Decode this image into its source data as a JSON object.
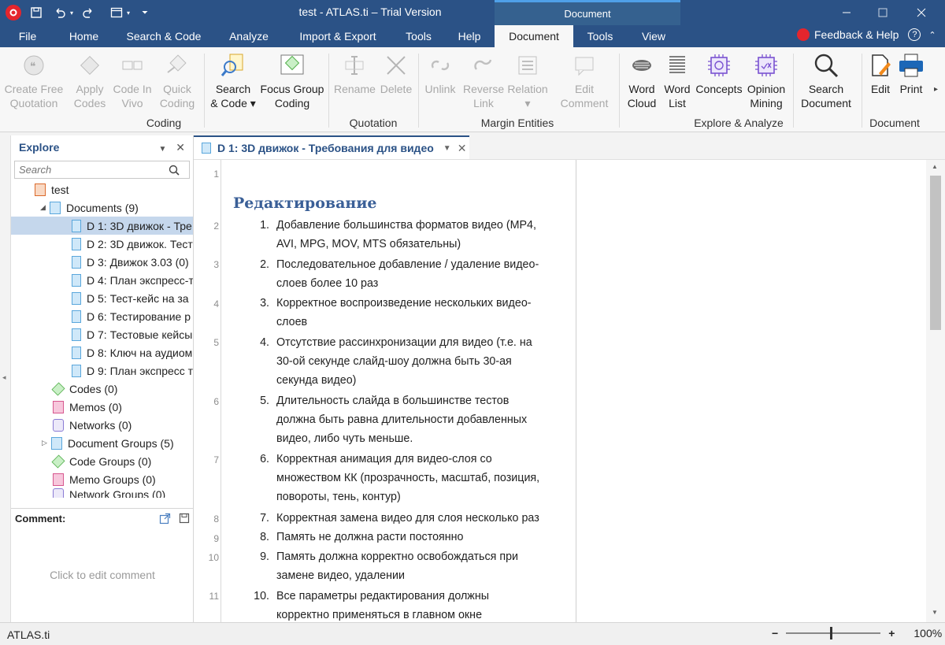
{
  "window": {
    "title": "test - ATLAS.ti – Trial Version",
    "context_tab_group": "Document"
  },
  "menu_tabs": [
    {
      "label": "File"
    },
    {
      "label": "Home"
    },
    {
      "label": "Search & Code"
    },
    {
      "label": "Analyze"
    },
    {
      "label": "Import & Export"
    },
    {
      "label": "Tools"
    },
    {
      "label": "Help"
    },
    {
      "label": "Document"
    },
    {
      "label": "Tools"
    },
    {
      "label": "View"
    }
  ],
  "active_tab": "Document",
  "feedback_label": "Feedback & Help",
  "ribbon": {
    "buttons": {
      "create_free_quotation": [
        "Create Free",
        "Quotation"
      ],
      "apply_codes": [
        "Apply",
        "Codes"
      ],
      "code_in_vivo": [
        "Code In",
        "Vivo"
      ],
      "quick_coding": [
        "Quick",
        "Coding"
      ],
      "search_code": [
        "Search",
        "& Code ▾"
      ],
      "focus_group_coding": [
        "Focus Group",
        "Coding"
      ],
      "rename": [
        "Rename",
        ""
      ],
      "delete": [
        "Delete",
        ""
      ],
      "unlink": [
        "Unlink",
        ""
      ],
      "reverse_link": [
        "Reverse",
        "Link"
      ],
      "relation": [
        "Relation",
        "▾"
      ],
      "edit_comment": [
        "Edit",
        "Comment"
      ],
      "word_cloud": [
        "Word",
        "Cloud"
      ],
      "word_list": [
        "Word",
        "List"
      ],
      "concepts": [
        "Concepts",
        ""
      ],
      "opinion_mining": [
        "Opinion",
        "Mining"
      ],
      "search_document": [
        "Search",
        "Document"
      ],
      "edit": [
        "Edit",
        ""
      ],
      "print": [
        "Print",
        ""
      ]
    },
    "groups": {
      "coding": "Coding",
      "quotation": "Quotation",
      "margin_entities": "Margin Entities",
      "explore_analyze": "Explore & Analyze",
      "document": "Document"
    }
  },
  "explore": {
    "title": "Explore",
    "search_placeholder": "Search",
    "project": "test",
    "documents_folder": "Documents (9)",
    "documents": [
      "D 1: 3D движок - Тре",
      "D 2: 3D движок. Тест",
      "D 3: Движок 3.03 (0)",
      "D 4: План экспресс-т",
      "D 5: Тест-кейс на за",
      "D 6: Тестирование р",
      "D 7: Тестовые кейсы",
      "D 8: Ключ на аудиом",
      "D 9: План экспресс т"
    ],
    "other_nodes": [
      {
        "label": "Codes (0)",
        "icon": "code-icon"
      },
      {
        "label": "Memos (0)",
        "icon": "memo-icon"
      },
      {
        "label": "Networks (0)",
        "icon": "network-icon"
      },
      {
        "label": "Document Groups (5)",
        "icon": "document-group-icon"
      },
      {
        "label": "Code Groups (0)",
        "icon": "code-group-icon"
      },
      {
        "label": "Memo Groups (0)",
        "icon": "memo-group-icon"
      },
      {
        "label": "Network Groups (0)",
        "icon": "network-group-icon"
      }
    ]
  },
  "comment": {
    "title": "Comment:",
    "hint": "Click to edit comment"
  },
  "document_tab": {
    "title": "D 1: 3D движок - Требования для видео"
  },
  "document": {
    "heading": "Редактирование",
    "line_numbers": [
      "1",
      "2",
      "3",
      "4",
      "5",
      "6",
      "7",
      "8",
      "9",
      "10",
      "11"
    ],
    "items": [
      {
        "num": "1.",
        "lines": [
          "Добавление большинства форматов видео (MP4,",
          "AVI, MPG, MOV, MTS обязательны)"
        ]
      },
      {
        "num": "2.",
        "lines": [
          "Последовательное добавление / удаление видео-",
          "слоев более 10 раз"
        ]
      },
      {
        "num": "3.",
        "lines": [
          "Корректное воспроизведение нескольких видео-",
          "слоев"
        ]
      },
      {
        "num": "4.",
        "lines": [
          "Отсутствие рассинхронизации для видео (т.е. на",
          "30-ой секунде слайд-шоу должна быть 30-ая",
          "секунда видео)"
        ]
      },
      {
        "num": "5.",
        "lines": [
          "Длительность слайда в большинстве тестов",
          "должна быть равна длительности добавленных",
          "видео, либо чуть меньше."
        ]
      },
      {
        "num": "6.",
        "lines": [
          "Корректная анимация для видео-слоя со",
          "множеством КК (прозрачность, масштаб, позиция,",
          "повороты, тень, контур)"
        ]
      },
      {
        "num": "7.",
        "lines": [
          "Корректная замена видео для слоя несколько раз"
        ]
      },
      {
        "num": "8.",
        "lines": [
          "Память не должна расти постоянно"
        ]
      },
      {
        "num": "9.",
        "lines": [
          "Память должна корректно освобождаться при",
          "замене видео, удалении"
        ]
      },
      {
        "num": "10.",
        "lines": [
          "Все параметры редактирования должны",
          "корректно применяться в главном окне"
        ]
      }
    ]
  },
  "status": {
    "app": "ATLAS.ti",
    "zoom_value": "100%",
    "zoom_minus": "−",
    "zoom_plus": "+"
  },
  "colors": {
    "title_bar": "#2b5286",
    "heading": "#3a5f97",
    "selection": "#c5d7ec"
  }
}
